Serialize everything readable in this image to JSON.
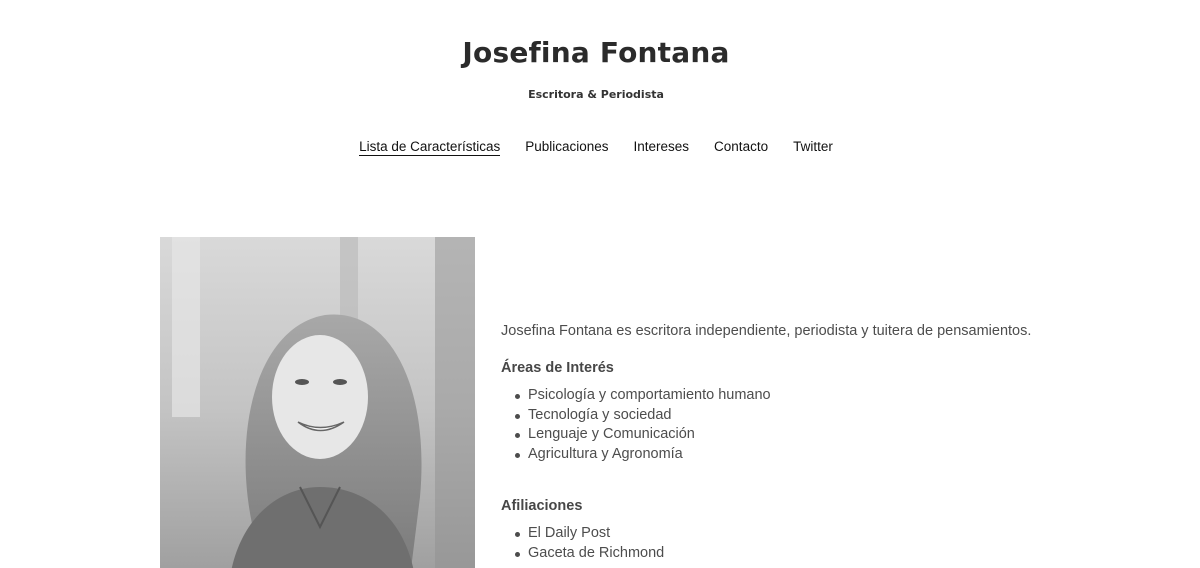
{
  "header": {
    "title": "Josefina Fontana",
    "tagline": "Escritora & Periodista"
  },
  "nav": {
    "items": [
      {
        "label": "Lista de Características",
        "active": true
      },
      {
        "label": "Publicaciones",
        "active": false
      },
      {
        "label": "Intereses",
        "active": false
      },
      {
        "label": "Contacto",
        "active": false
      },
      {
        "label": "Twitter",
        "active": false
      }
    ]
  },
  "main": {
    "intro": "Josefina Fontana es escritora independiente, periodista y tuitera de pensamientos.",
    "interests_heading": "Áreas de Interés",
    "interests": [
      "Psicología y comportamiento humano",
      "Tecnología y sociedad",
      "Lenguaje y Comunicación",
      "Agricultura y Agronomía"
    ],
    "affiliations_heading": "Afiliaciones",
    "affiliations": [
      "El Daily Post",
      "Gaceta de Richmond"
    ]
  },
  "portrait": {
    "icon": "portrait-photo",
    "style": "grayscale"
  }
}
